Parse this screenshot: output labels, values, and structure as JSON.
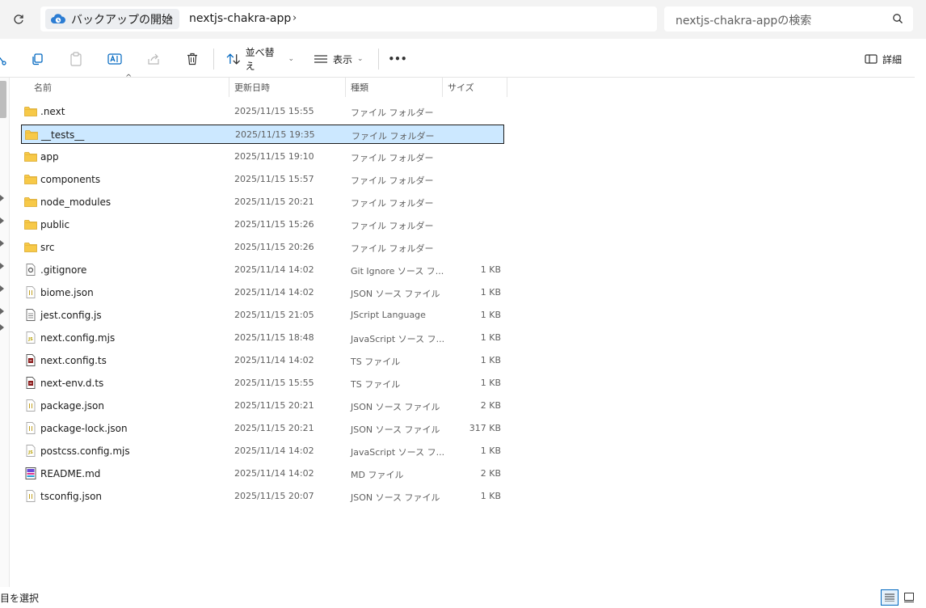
{
  "address": {
    "home_label": "バックアップの開始",
    "folder_label": "nextjs-chakra-app",
    "search_placeholder": "nextjs-chakra-appの検索"
  },
  "toolbar": {
    "sort_label": "並べ替え",
    "view_label": "表示",
    "more_label": "•••",
    "details_label": "詳細"
  },
  "columns": {
    "name": "名前",
    "date": "更新日時",
    "type": "種類",
    "size": "サイズ"
  },
  "files": [
    {
      "name": ".next",
      "date": "2025/11/15 15:55",
      "type": "ファイル フォルダー",
      "size": "",
      "icon": "folder-icon"
    },
    {
      "name": "__tests__",
      "date": "2025/11/15 19:35",
      "type": "ファイル フォルダー",
      "size": "",
      "icon": "folder-icon",
      "selected": true
    },
    {
      "name": "app",
      "date": "2025/11/15 19:10",
      "type": "ファイル フォルダー",
      "size": "",
      "icon": "folder-icon"
    },
    {
      "name": "components",
      "date": "2025/11/15 15:57",
      "type": "ファイル フォルダー",
      "size": "",
      "icon": "folder-icon"
    },
    {
      "name": "node_modules",
      "date": "2025/11/15 20:21",
      "type": "ファイル フォルダー",
      "size": "",
      "icon": "folder-icon"
    },
    {
      "name": "public",
      "date": "2025/11/15 15:26",
      "type": "ファイル フォルダー",
      "size": "",
      "icon": "folder-icon"
    },
    {
      "name": "src",
      "date": "2025/11/15 20:26",
      "type": "ファイル フォルダー",
      "size": "",
      "icon": "folder-icon"
    },
    {
      "name": ".gitignore",
      "date": "2025/11/14 14:02",
      "type": "Git Ignore ソース フ...",
      "size": "1 KB",
      "icon": "gitignore-file-icon"
    },
    {
      "name": "biome.json",
      "date": "2025/11/14 14:02",
      "type": "JSON ソース ファイル",
      "size": "1 KB",
      "icon": "json-file-icon"
    },
    {
      "name": "jest.config.js",
      "date": "2025/11/15 21:05",
      "type": "JScript Language",
      "size": "1 KB",
      "icon": "text-file-icon"
    },
    {
      "name": "next.config.mjs",
      "date": "2025/11/15 18:48",
      "type": "JavaScript ソース フ...",
      "size": "1 KB",
      "icon": "js-file-icon"
    },
    {
      "name": "next.config.ts",
      "date": "2025/11/14 14:02",
      "type": "TS ファイル",
      "size": "1 KB",
      "icon": "ts-file-icon"
    },
    {
      "name": "next-env.d.ts",
      "date": "2025/11/15 15:55",
      "type": "TS ファイル",
      "size": "1 KB",
      "icon": "ts-file-icon"
    },
    {
      "name": "package.json",
      "date": "2025/11/15 20:21",
      "type": "JSON ソース ファイル",
      "size": "2 KB",
      "icon": "json-file-icon"
    },
    {
      "name": "package-lock.json",
      "date": "2025/11/15 20:21",
      "type": "JSON ソース ファイル",
      "size": "317 KB",
      "icon": "json-file-icon"
    },
    {
      "name": "postcss.config.mjs",
      "date": "2025/11/14 14:02",
      "type": "JavaScript ソース フ...",
      "size": "1 KB",
      "icon": "js-file-icon"
    },
    {
      "name": "README.md",
      "date": "2025/11/14 14:02",
      "type": "MD ファイル",
      "size": "2 KB",
      "icon": "md-file-icon"
    },
    {
      "name": "tsconfig.json",
      "date": "2025/11/15 20:07",
      "type": "JSON ソース ファイル",
      "size": "1 KB",
      "icon": "json-file-icon"
    }
  ],
  "status": {
    "text": "目を選択"
  },
  "colors": {
    "selection_bg": "#cce8ff",
    "folder_yellow": "#f7c948",
    "accent": "#0067c0"
  }
}
